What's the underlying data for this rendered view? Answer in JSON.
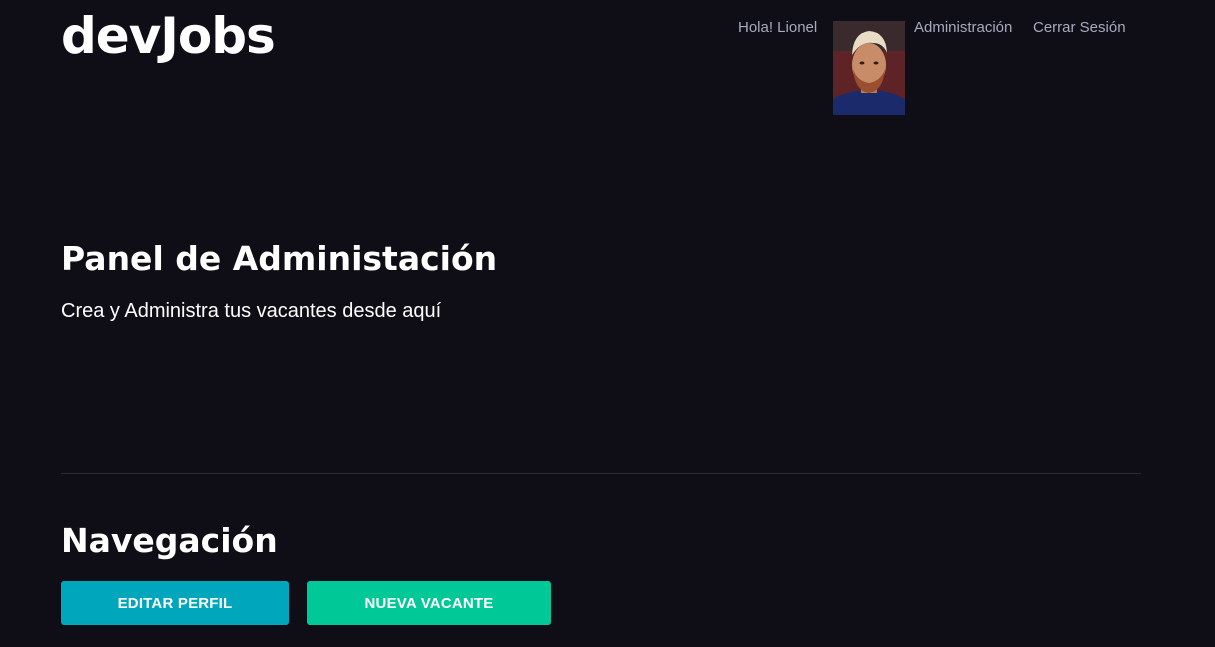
{
  "brand": {
    "logo": "devJobs"
  },
  "header": {
    "greeting": "Hola! Lionel",
    "nav_admin": "Administración",
    "nav_logout": "Cerrar Sesión",
    "avatar_icon": "user-avatar-photo"
  },
  "main": {
    "title": "Panel de Administación",
    "subtitle": "Crea y Administra tus vacantes desde aquí"
  },
  "navigation": {
    "title": "Navegación",
    "edit_profile_label": "EDITAR PERFIL",
    "new_vacancy_label": "NUEVA VACANTE"
  },
  "colors": {
    "background": "#0f0e17",
    "text": "#fffffe",
    "nav_text": "#a7a9be",
    "edit_button": "#00a6bb",
    "new_button": "#00c897"
  }
}
